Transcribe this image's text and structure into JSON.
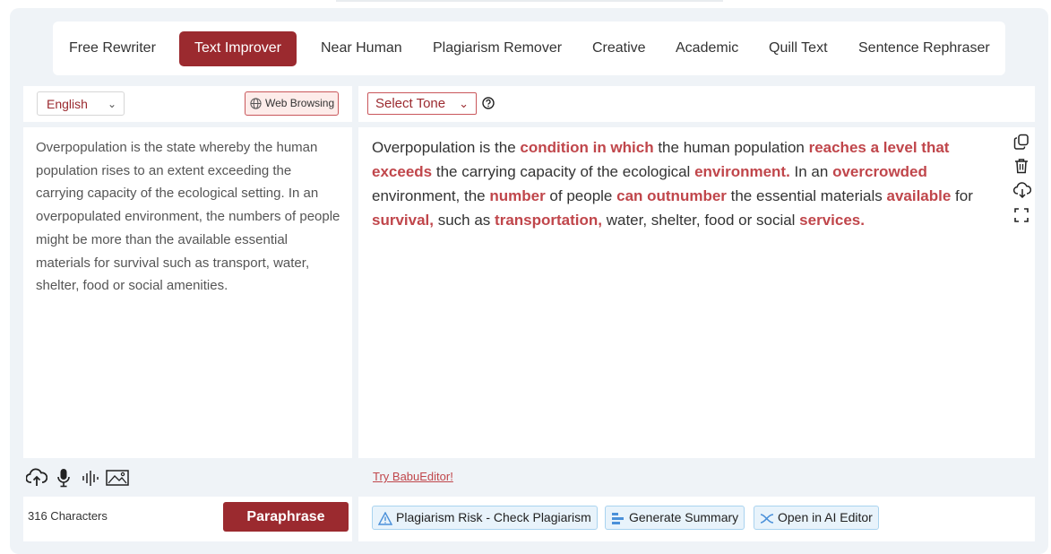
{
  "tabs": [
    {
      "label": "Free Rewriter",
      "active": false
    },
    {
      "label": "Text Improver",
      "active": true
    },
    {
      "label": "Near Human",
      "active": false
    },
    {
      "label": "Plagiarism Remover",
      "active": false
    },
    {
      "label": "Creative",
      "active": false
    },
    {
      "label": "Academic",
      "active": false
    },
    {
      "label": "Quill Text",
      "active": false
    },
    {
      "label": "Sentence Rephraser",
      "active": false
    }
  ],
  "input_panel": {
    "language": "English",
    "web_browsing_label": "Web Browsing",
    "text": "Overpopulation is the state whereby the human population rises to an extent exceeding the carrying capacity of the ecological setting. In an overpopulated environment, the numbers of people might be more than the available essential materials for survival such as transport, water, shelter, food or social amenities.",
    "tools": [
      "upload-icon",
      "microphone-icon",
      "audio-wave-icon",
      "image-icon"
    ],
    "char_count": "316 Characters",
    "paraphrase_label": "Paraphrase"
  },
  "output_panel": {
    "tone_label": "Select Tone",
    "help_icon": "question-circle-icon",
    "segments": [
      {
        "text": "Overpopulation is the ",
        "hl": false
      },
      {
        "text": "condition in which",
        "hl": true
      },
      {
        "text": " the human population ",
        "hl": false
      },
      {
        "text": "reaches a level that exceeds",
        "hl": true
      },
      {
        "text": " the carrying capacity of the ecological ",
        "hl": false
      },
      {
        "text": "environment.",
        "hl": true
      },
      {
        "text": " In an ",
        "hl": false
      },
      {
        "text": "overcrowded",
        "hl": true
      },
      {
        "text": " environment, the ",
        "hl": false
      },
      {
        "text": "number",
        "hl": true
      },
      {
        "text": " of people ",
        "hl": false
      },
      {
        "text": "can outnumber",
        "hl": true
      },
      {
        "text": " the essential materials ",
        "hl": false
      },
      {
        "text": "available",
        "hl": true
      },
      {
        "text": " for ",
        "hl": false
      },
      {
        "text": "survival,",
        "hl": true
      },
      {
        "text": " such as ",
        "hl": false
      },
      {
        "text": "transportation,",
        "hl": true
      },
      {
        "text": " water, shelter, food or social ",
        "hl": false
      },
      {
        "text": "services.",
        "hl": true
      }
    ],
    "side_tools": [
      "copy-icon",
      "trash-icon",
      "download-icon",
      "fullscreen-icon"
    ],
    "try_link": "Try BabuEditor!",
    "actions": [
      {
        "label": "Plagiarism Risk - Check Plagiarism",
        "icon": "warning-icon"
      },
      {
        "label": "Generate Summary",
        "icon": "summary-icon"
      },
      {
        "label": "Open in AI Editor",
        "icon": "ai-editor-icon"
      }
    ]
  },
  "colors": {
    "accent": "#9b2a2f",
    "highlight": "#c0464b",
    "background": "#eff3f7",
    "action_bg": "#e8f3fb",
    "action_border": "#a9d3ef"
  }
}
